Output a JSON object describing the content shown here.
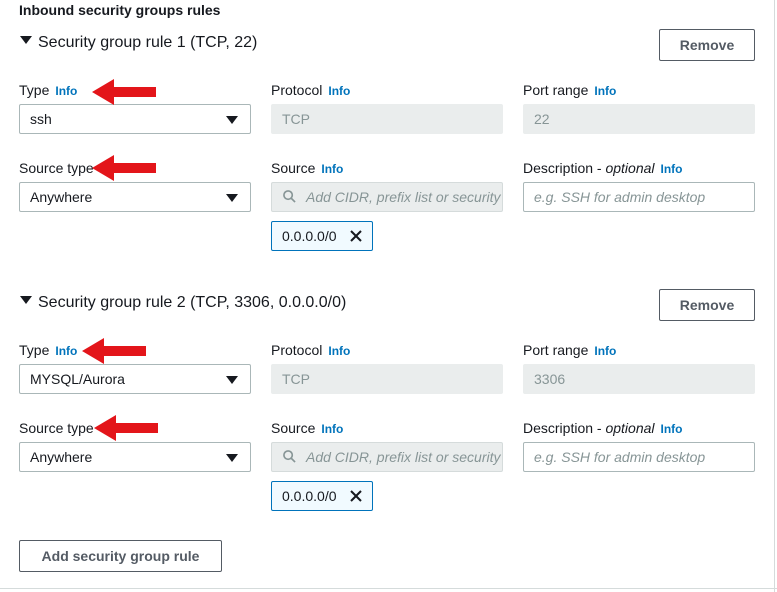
{
  "section_title": "Inbound security groups rules",
  "rules": [
    {
      "title": "Security group rule 1 (TCP, 22)",
      "remove_label": "Remove",
      "type_label": "Type",
      "type_value": "ssh",
      "protocol_label": "Protocol",
      "protocol_value": "TCP",
      "port_label": "Port range",
      "port_value": "22",
      "source_type_label": "Source type",
      "source_type_value": "Anywhere",
      "source_label": "Source",
      "source_placeholder": "Add CIDR, prefix list or security group",
      "source_token": "0.0.0.0/0",
      "description_label": "Description - ",
      "description_optional": "optional",
      "description_placeholder": "e.g. SSH for admin desktop"
    },
    {
      "title": "Security group rule 2 (TCP, 3306, 0.0.0.0/0)",
      "remove_label": "Remove",
      "type_label": "Type",
      "type_value": "MYSQL/Aurora",
      "protocol_label": "Protocol",
      "protocol_value": "TCP",
      "port_label": "Port range",
      "port_value": "3306",
      "source_type_label": "Source type",
      "source_type_value": "Anywhere",
      "source_label": "Source",
      "source_placeholder": "Add CIDR, prefix list or security group",
      "source_token": "0.0.0.0/0",
      "description_label": "Description - ",
      "description_optional": "optional",
      "description_placeholder": "e.g. SSH for admin desktop"
    }
  ],
  "info_link": "Info",
  "add_rule_label": "Add security group rule",
  "colors": {
    "info_link": "#0073bb",
    "annotation_arrow": "#e3151a",
    "token_border": "#0073bb",
    "disabled_field": "#eaeded"
  },
  "icons": [
    "caret-down-icon",
    "search-icon",
    "close-icon",
    "red-arrow-annotation"
  ]
}
